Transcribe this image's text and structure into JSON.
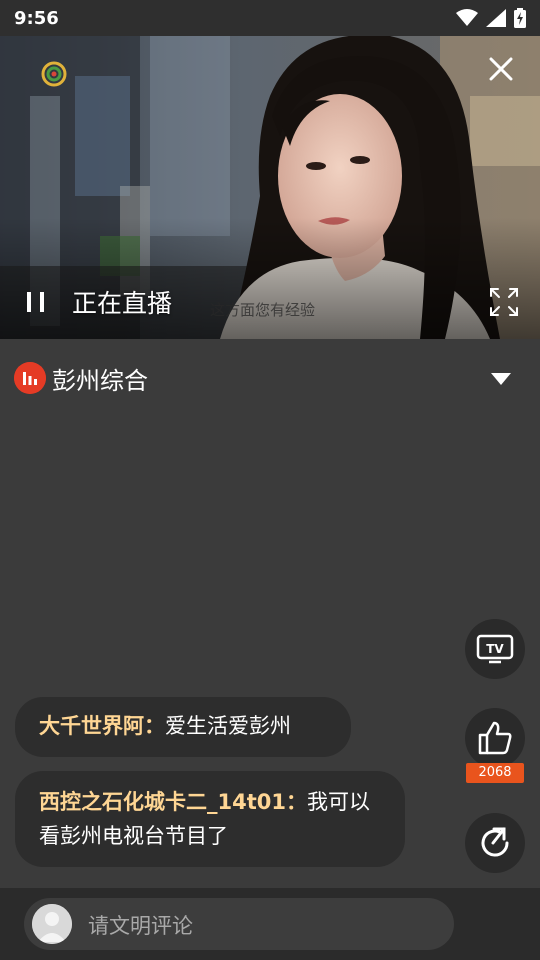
{
  "status_bar": {
    "time": "9:56",
    "icons": [
      "wifi-icon",
      "cellular-signal-icon",
      "battery-charging-icon"
    ]
  },
  "player": {
    "live_label": "正在直播",
    "subtitle": "这方面您有经验",
    "icons": [
      "close-icon",
      "pause-icon",
      "fullscreen-icon"
    ]
  },
  "channel": {
    "name": "彭州综合",
    "icon": "audio-bars-icon",
    "dropdown_icon": "caret-down-icon"
  },
  "side_actions": {
    "tv_icon": "tv-cast-icon",
    "like_icon": "thumbs-up-icon",
    "like_count": "2068",
    "share_icon": "share-icon"
  },
  "comments": [
    {
      "user": "大千世界阿",
      "separator": "：",
      "text": "爱生活爱彭州"
    },
    {
      "user": "西控之石化城卡二_14t01",
      "separator": "：",
      "text": "我可以看彭州电视台节目了"
    }
  ],
  "comment_input": {
    "placeholder": "请文明评论"
  },
  "colors": {
    "background": "#3b3b3b",
    "accent_red": "#e53b25",
    "like_badge": "#e9541d",
    "username": "#ffd694"
  }
}
